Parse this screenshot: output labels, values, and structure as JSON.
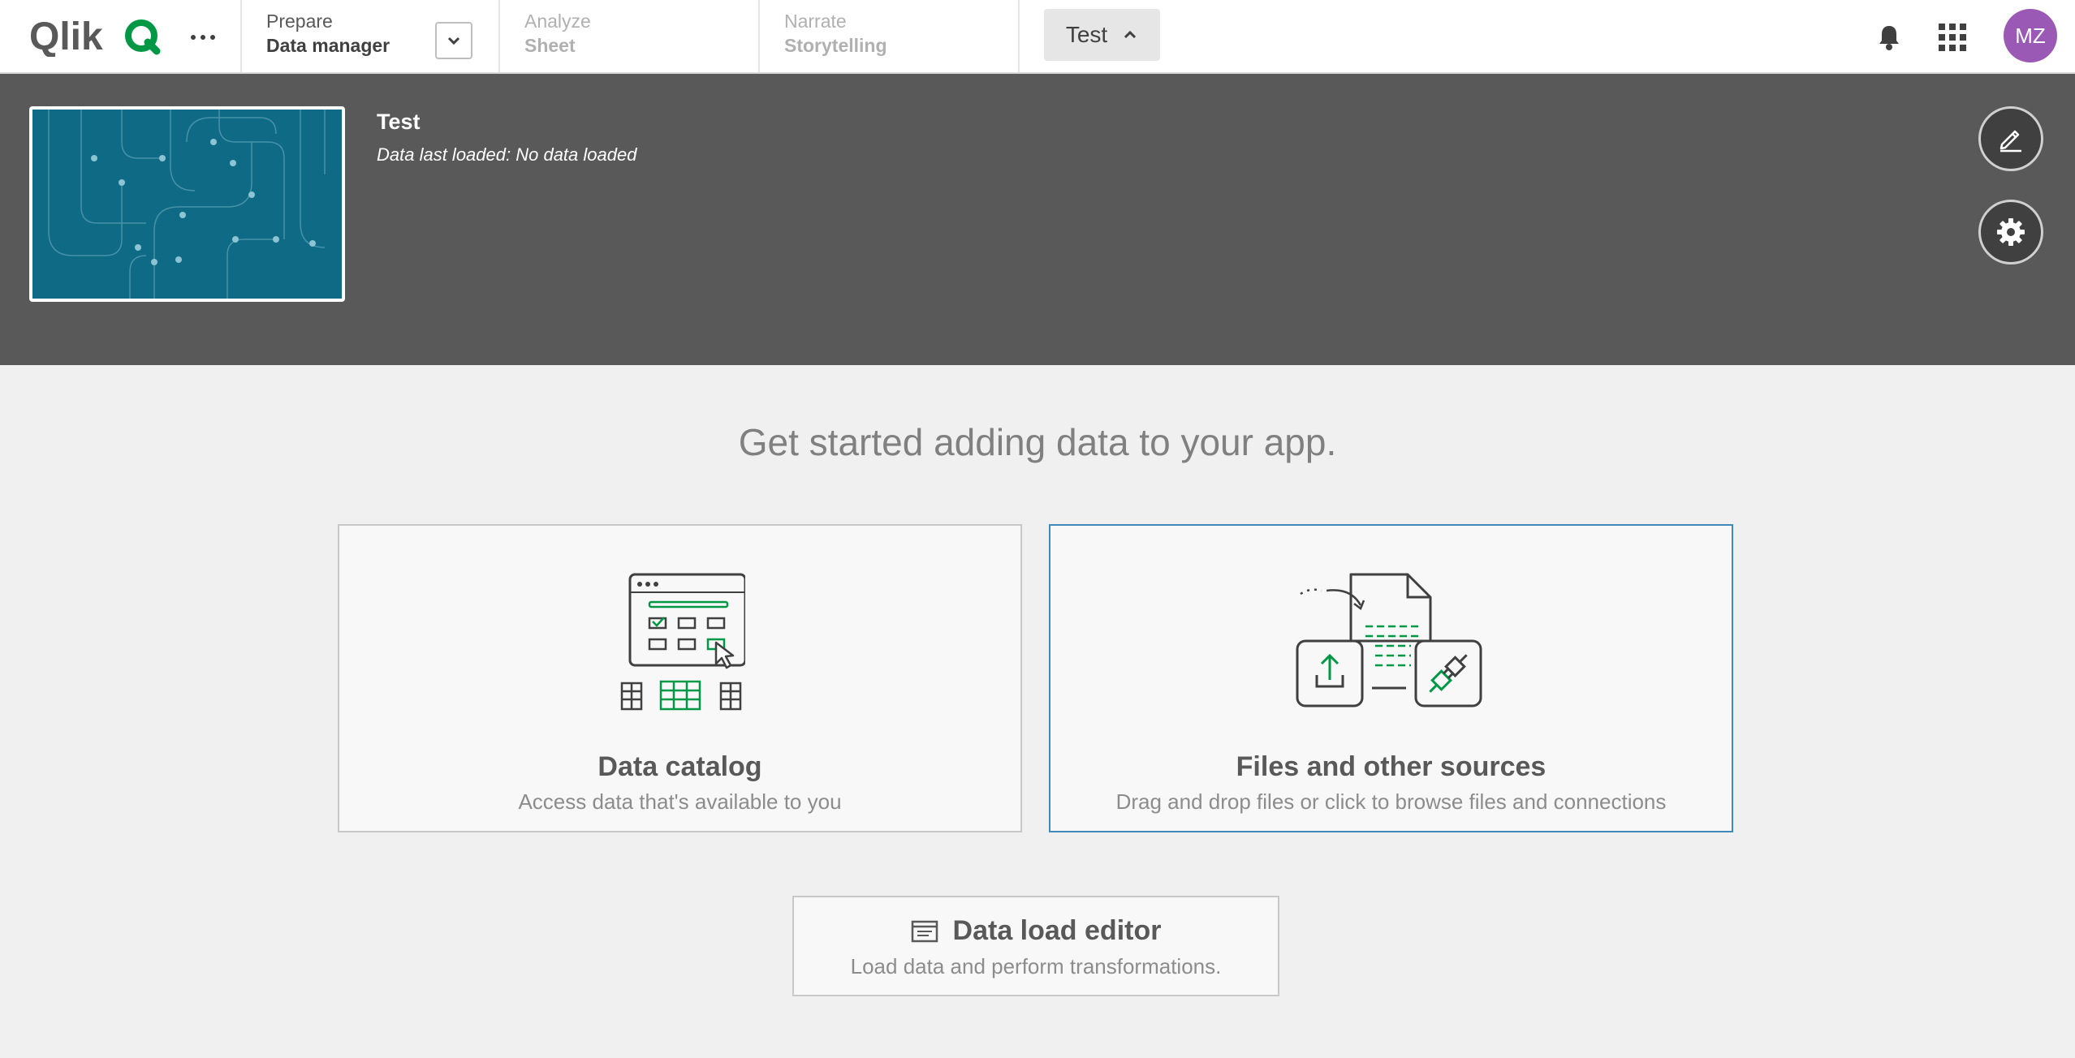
{
  "brand": {
    "name": "Qlik",
    "accent": "#009845"
  },
  "nav": {
    "prepare": {
      "label": "Prepare",
      "value": "Data manager"
    },
    "analyze": {
      "label": "Analyze",
      "value": "Sheet"
    },
    "narrate": {
      "label": "Narrate",
      "value": "Storytelling"
    }
  },
  "app_button": {
    "label": "Test"
  },
  "user": {
    "initials": "MZ",
    "color": "#9b59b6"
  },
  "app": {
    "title": "Test",
    "data_status": "Data last loaded: No data loaded"
  },
  "main": {
    "headline": "Get started adding data to your app.",
    "cards": [
      {
        "title": "Data catalog",
        "description": "Access data that's available to you"
      },
      {
        "title": "Files and other sources",
        "description": "Drag and drop files or click to browse files and connections"
      }
    ],
    "data_load_editor": {
      "title": "Data load editor",
      "description": "Load data and perform transformations."
    }
  },
  "icons": {
    "more": "more-dots-icon",
    "dropdown": "chevron-down-icon",
    "app_chevron": "chevron-up-icon",
    "notifications": "bell-icon",
    "apps_grid": "apps-grid-icon",
    "edit": "pencil-icon",
    "settings": "gear-icon",
    "script": "script-editor-icon"
  }
}
